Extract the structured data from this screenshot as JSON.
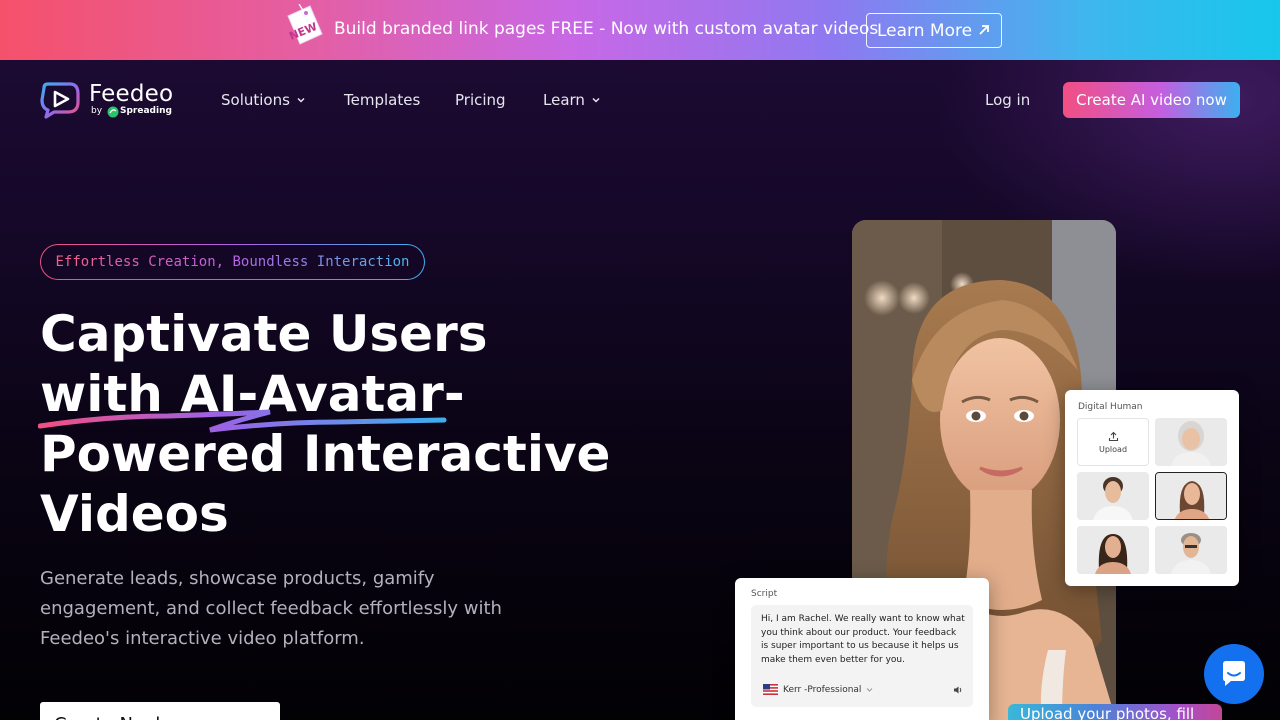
{
  "banner": {
    "new_badge": "NEW",
    "text": "Build branded link pages FREE - Now with custom avatar videos",
    "learn_more": "Learn More"
  },
  "nav": {
    "brand": "Feedeo",
    "by": "by",
    "parent_brand": "Spreading",
    "items": [
      {
        "label": "Solutions",
        "has_dropdown": true
      },
      {
        "label": "Templates",
        "has_dropdown": false
      },
      {
        "label": "Pricing",
        "has_dropdown": false
      },
      {
        "label": "Learn",
        "has_dropdown": true
      }
    ],
    "login": "Log in",
    "cta": "Create AI video now"
  },
  "hero": {
    "tagline": "Effortless Creation, Boundless Interaction",
    "headline_lines": [
      "Captivate Users",
      "with AI-Avatar-",
      "Powered Interactive",
      "Videos"
    ],
    "subtext": "Generate leads, showcase products, gamify engagement, and collect feedback effortlessly with Feedeo's interactive video platform.",
    "cta": "Create Nnabo..."
  },
  "digital_human": {
    "title": "Digital Human",
    "upload_label": "Upload",
    "selected_index": 3
  },
  "script_card": {
    "title": "Script",
    "text": "Hi, I am Rachel. We really want to know what you think about our product. Your feedback is super important to us because it helps us make them even better for you.",
    "voice": "Kerr -Professional"
  },
  "caption": "Upload your photos, fill",
  "colors": {
    "accent_pink": "#f24f82",
    "accent_purple": "#b161e6",
    "accent_blue": "#3dafef",
    "chat_blue": "#1371f0"
  },
  "icons": [
    "new-tag-icon",
    "external-arrow-icon",
    "feedeo-logo-icon",
    "chevron-down-icon",
    "upload-icon",
    "us-flag-icon",
    "speaker-icon",
    "chat-bubble-icon"
  ]
}
